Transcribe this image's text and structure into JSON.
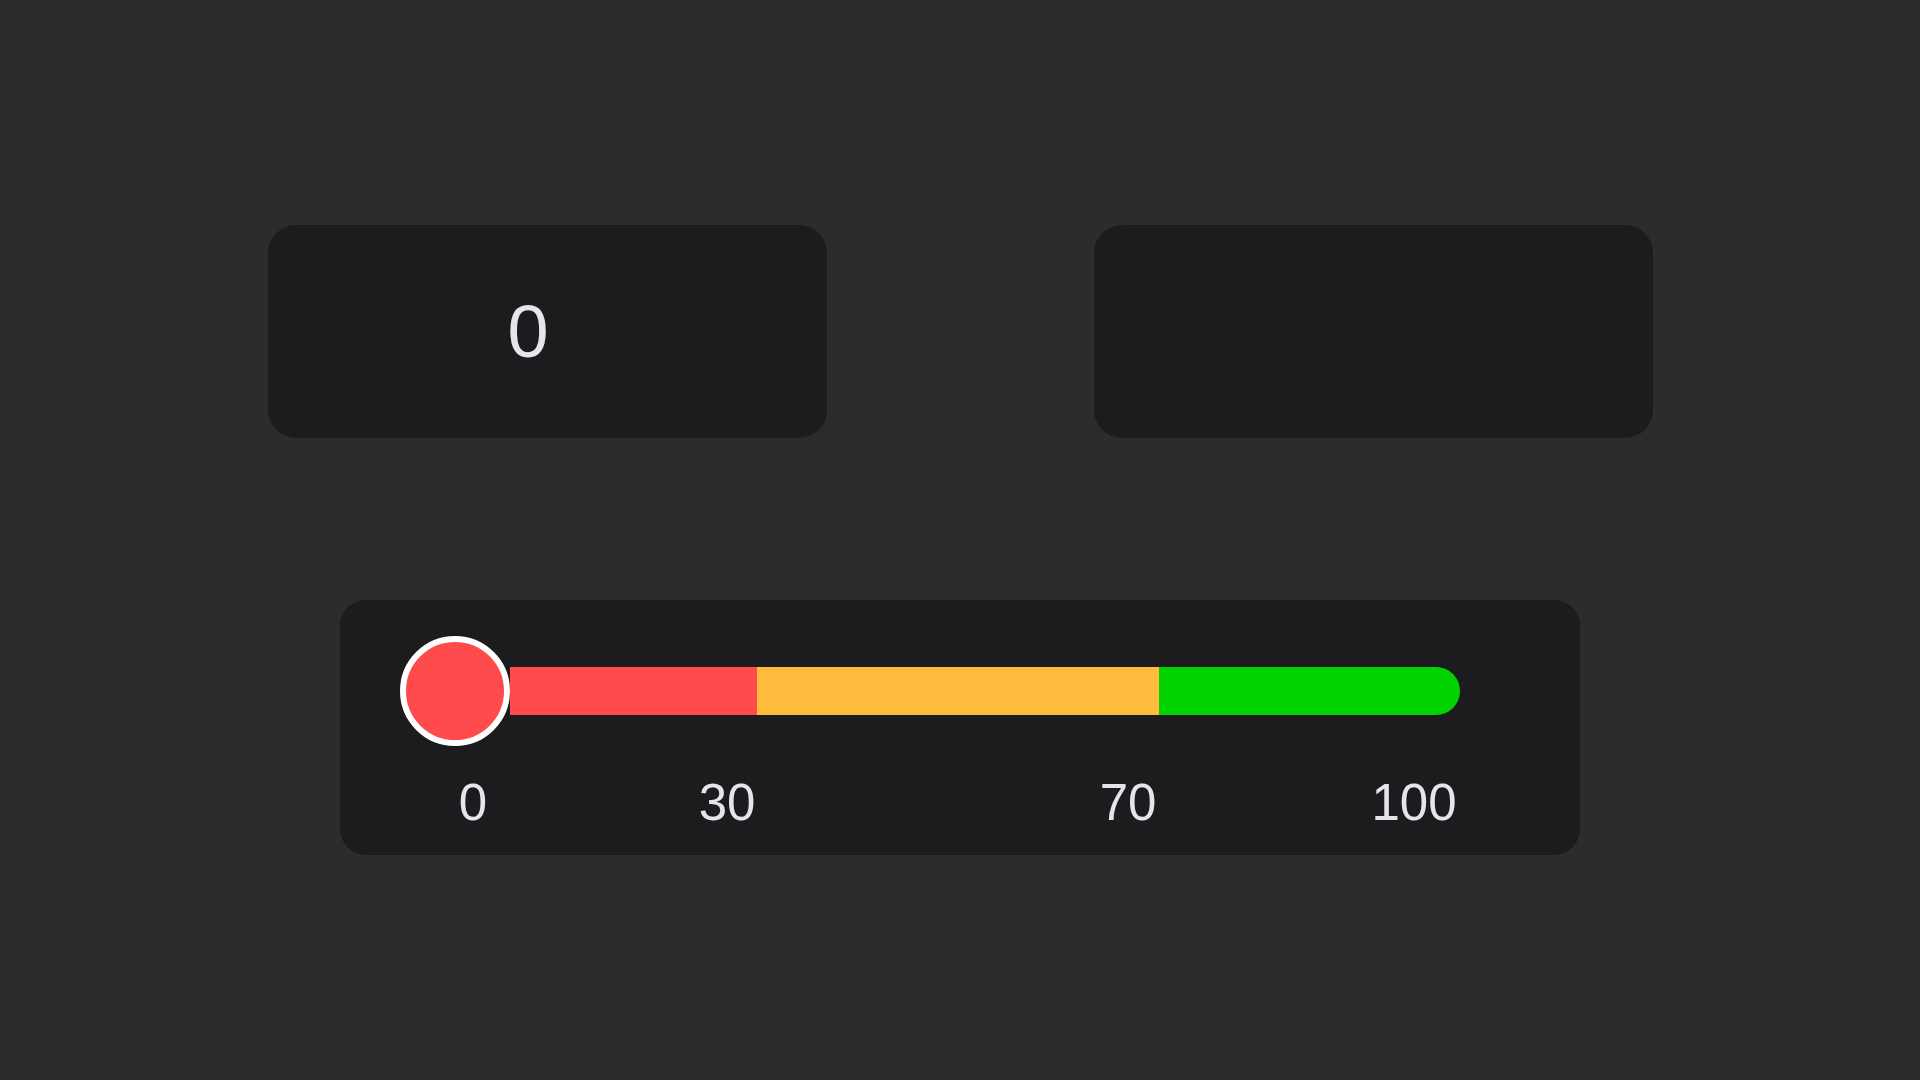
{
  "cards": [
    {
      "kind": "value",
      "value": "0"
    },
    {
      "kind": "empty"
    }
  ],
  "slider": {
    "level": 0,
    "segments": [
      {
        "color": "#ff4b4b"
      },
      {
        "color": "#ffbb3c"
      },
      {
        "color": "#00d300"
      }
    ],
    "ticks": [
      "0",
      "30",
      "70",
      "100"
    ]
  }
}
